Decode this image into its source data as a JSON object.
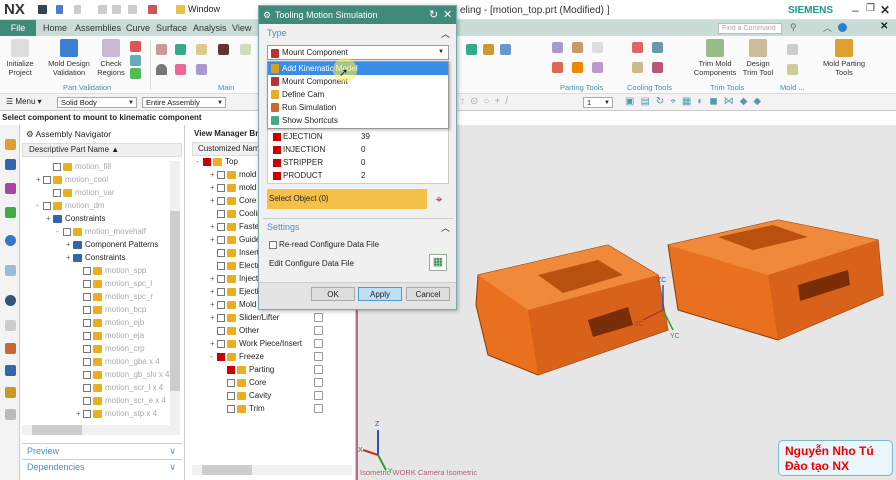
{
  "app": {
    "logo": "NX",
    "title": "eling - [motion_top.prt (Modified) ]",
    "brand": "SIEMENS",
    "window_menu": "Window"
  },
  "tabs": {
    "file": "File",
    "items": [
      "Home",
      "Assemblies",
      "Curve",
      "Surface",
      "Analysis",
      "View"
    ],
    "find_placeholder": "Find a Command"
  },
  "ribbon": {
    "initialize": "Initialize Project",
    "mold_validation": "Mold Design Validation",
    "check_regions": "Check Regions",
    "group_part_validation": "Part Validation",
    "group_main": "Main",
    "group_parting": "Parting Tools",
    "group_cooling": "Cooling Tools",
    "trim_mold": "Trim Mold Components",
    "design_trim": "Design Trim Tool",
    "group_trim": "Trim Tools",
    "group_mold": "Mold ...",
    "mold_parting": "Mold Parting Tools"
  },
  "toolbar": {
    "menu": "Menu",
    "filter": "Solid Body",
    "scope": "Entire Assembly",
    "layer": "1"
  },
  "status": "Select component to mount to kinematic component",
  "assembly_nav": {
    "title": "Assembly Navigator",
    "column": "Descriptive Part Name",
    "rows": [
      {
        "label": "motion_fill",
        "grey": true
      },
      {
        "label": "motion_cool",
        "grey": true
      },
      {
        "label": "motion_var",
        "grey": true
      },
      {
        "label": "motion_dm",
        "grey": true
      },
      {
        "label": "Constraints",
        "grey": false
      },
      {
        "label": "motion_movehalf",
        "grey": true
      },
      {
        "label": "Component Patterns",
        "grey": false
      },
      {
        "label": "Constraints",
        "grey": false
      },
      {
        "label": "motion_spp",
        "grey": true
      },
      {
        "label": "motion_spc_l",
        "grey": true
      },
      {
        "label": "motion_spc_r",
        "grey": true
      },
      {
        "label": "motion_bcp",
        "grey": true
      },
      {
        "label": "motion_ejb",
        "grey": true
      },
      {
        "label": "motion_eja",
        "grey": true
      },
      {
        "label": "motion_crp",
        "grey": true
      },
      {
        "label": "motion_gba x 4",
        "grey": true
      },
      {
        "label": "motion_gb_slv x 4",
        "grey": true
      },
      {
        "label": "motion_scr_l x 4",
        "grey": true
      },
      {
        "label": "motion_scr_e x 4",
        "grey": true
      },
      {
        "label": "motion_stp x 4",
        "grey": true
      }
    ],
    "preview": "Preview",
    "dependencies": "Dependencies"
  },
  "view_manager": {
    "title": "View Manager Browser",
    "column": "Customized Name",
    "rows": [
      "Top",
      "mold",
      "mold",
      "Core",
      "Cooling",
      "Fasteners",
      "Guide",
      "Insert",
      "Electrode",
      "Injection",
      "Ejection",
      "Mold",
      "Slider/Lifter",
      "Other",
      "Work Piece/Insert",
      "Freeze",
      "Parting",
      "Core",
      "Cavity",
      "Trim"
    ]
  },
  "dialog": {
    "title": "Tooling Motion Simulation",
    "type_section": "Type",
    "type_selected": "Mount Component",
    "type_options": [
      "Add Kinematic Model",
      "Mount Component",
      "Define Cam",
      "Run Simulation",
      "Show Shortcuts"
    ],
    "highlighted": 0,
    "list": [
      {
        "name": "EJECTION",
        "value": "39"
      },
      {
        "name": "INJECTION",
        "value": "0"
      },
      {
        "name": "STRIPPER",
        "value": "0"
      },
      {
        "name": "PRODUCT",
        "value": "2"
      }
    ],
    "select_object": "Select Object (0)",
    "settings_section": "Settings",
    "reread": "Re-read Configure Data File",
    "edit_config": "Edit Configure Data File",
    "ok": "OK",
    "apply": "Apply",
    "cancel": "Cancel"
  },
  "viewport": {
    "view_label": "Isometric WORK Camera Isometric",
    "axes": {
      "zc": "ZC",
      "xc": "XC",
      "yc": "YC",
      "z": "Z",
      "x": "X",
      "y": "Y"
    }
  },
  "watermark": {
    "line1": "Nguyễn Nho Tú",
    "line2": "Đào tạo NX"
  },
  "colors": {
    "accent": "#3f8a78",
    "part": "#e8701e",
    "select_bar": "#f5c04a",
    "highlight": "#3a8ee6"
  }
}
